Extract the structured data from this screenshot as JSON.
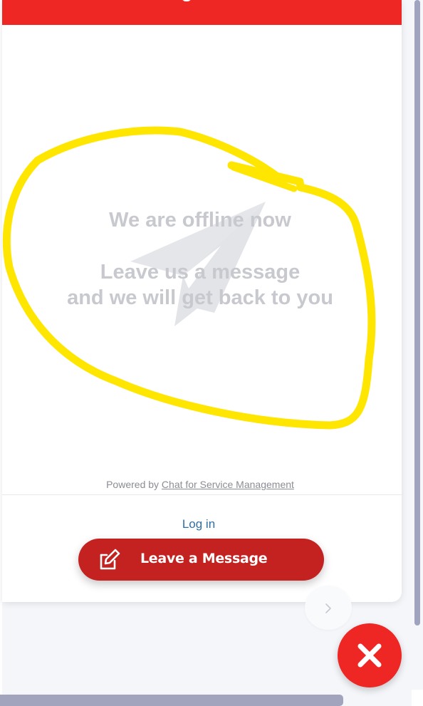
{
  "offline": {
    "line1": "We are offline now",
    "line2": "Leave us a message",
    "line3": "and we will get back to you"
  },
  "footer": {
    "powered_prefix": "Powered by",
    "powered_link": "Chat for Service Management"
  },
  "login": {
    "label": "Log in"
  },
  "leave_message": {
    "label": "Leave a Message"
  },
  "colors": {
    "brand_red": "#ee2624",
    "button_red": "#c42221",
    "offline_text": "#c7c9ce",
    "link_blue": "#2f6ea5",
    "annotation_yellow": "#ffe600"
  },
  "icons": {
    "header": "none",
    "illustration": "paper-plane-icon",
    "leave_button": "edit-icon",
    "next": "chevron-right-icon",
    "close": "close-icon"
  }
}
